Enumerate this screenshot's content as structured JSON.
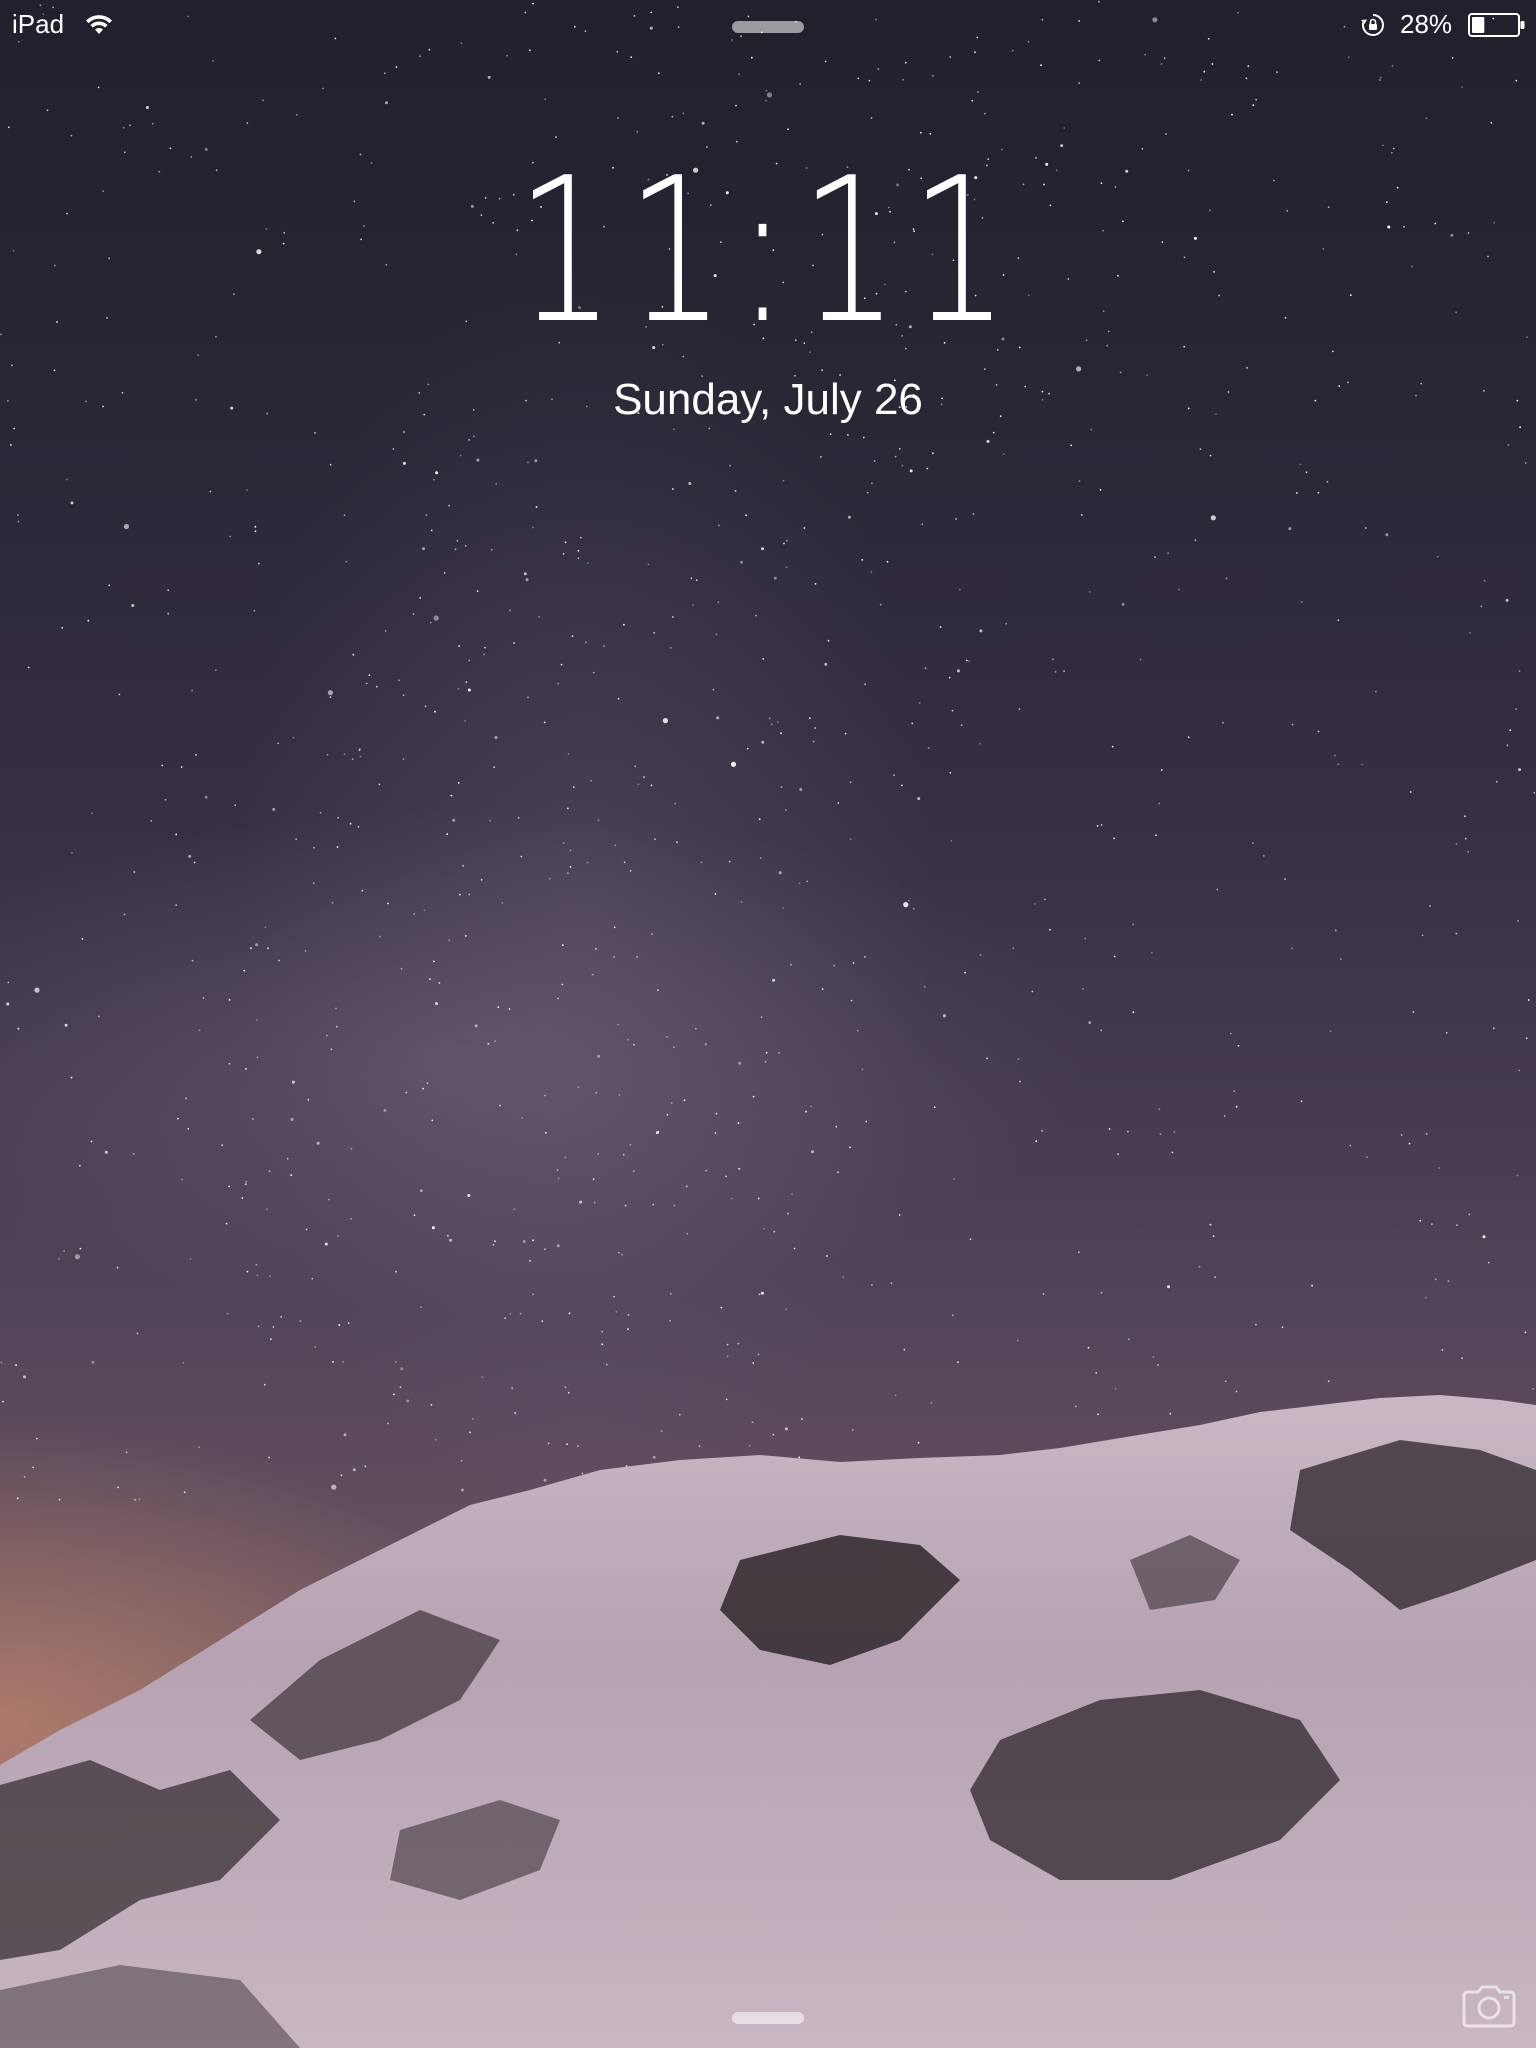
{
  "status_bar": {
    "carrier": "iPad",
    "battery_percent": "28%",
    "battery_level": 0.28,
    "icons": [
      "wifi-icon",
      "rotation-lock-icon",
      "battery-icon"
    ]
  },
  "lock_screen": {
    "time": "11:11",
    "date": "Sunday, July 26"
  },
  "bottom_bar": {
    "icons": [
      "camera-icon"
    ]
  }
}
